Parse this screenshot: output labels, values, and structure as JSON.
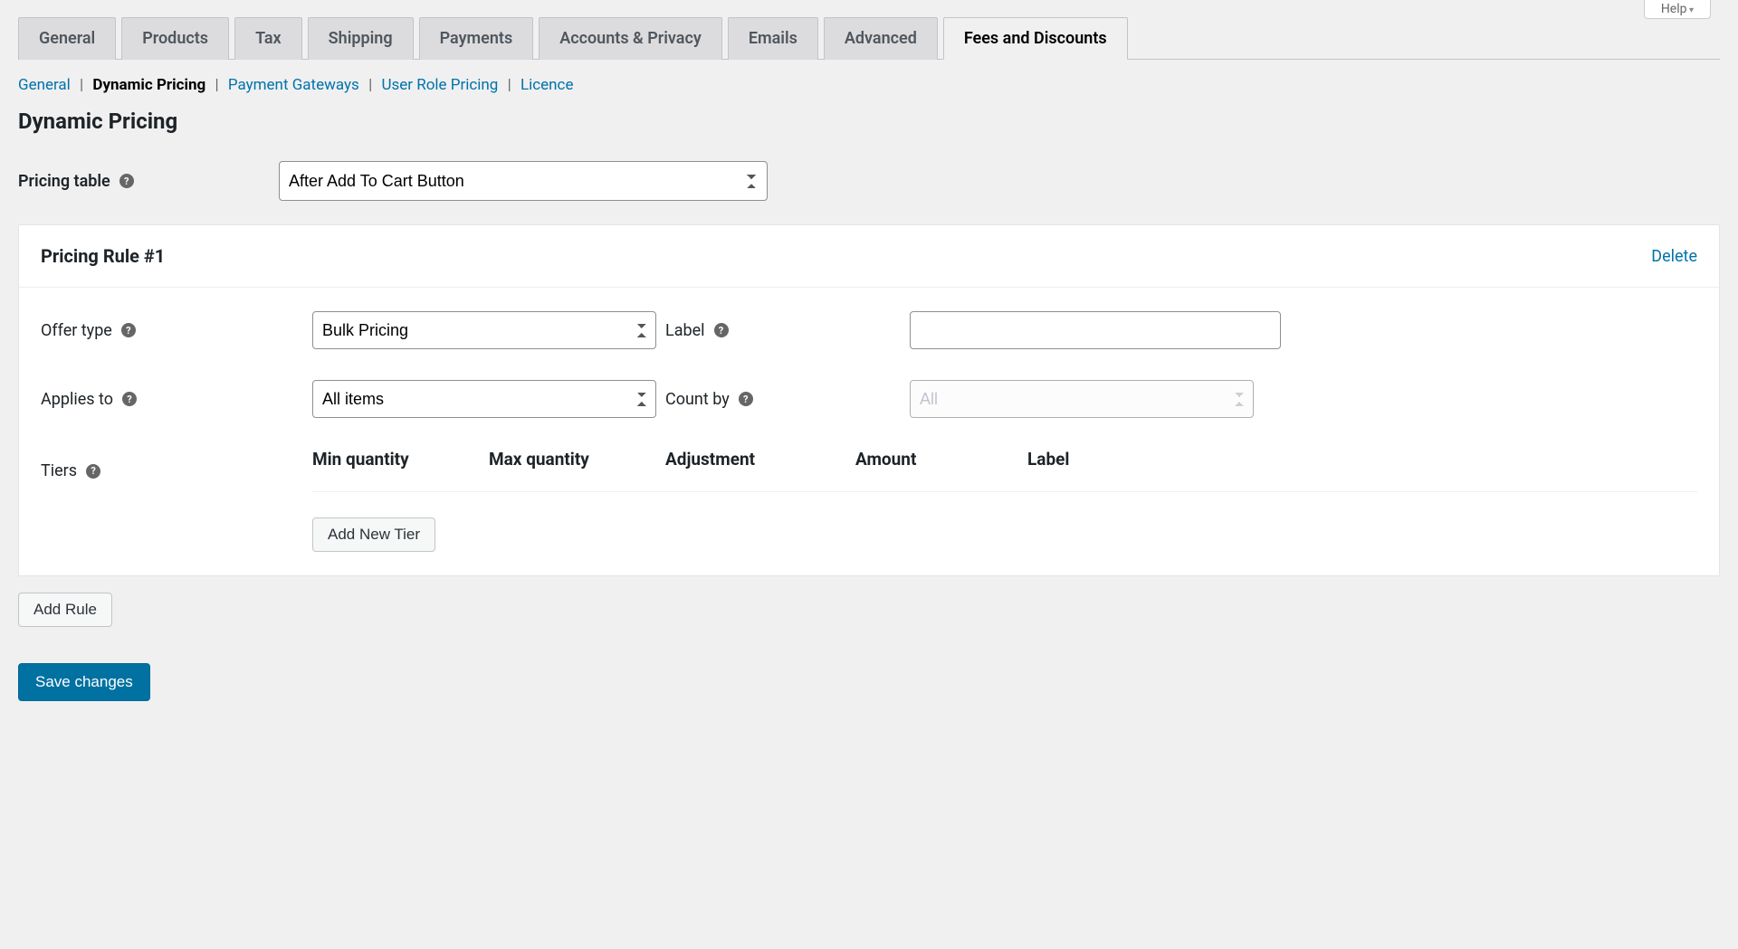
{
  "help_tab": "Help",
  "tabs": {
    "t0": "General",
    "t1": "Products",
    "t2": "Tax",
    "t3": "Shipping",
    "t4": "Payments",
    "t5": "Accounts & Privacy",
    "t6": "Emails",
    "t7": "Advanced",
    "t8": "Fees and Discounts"
  },
  "subnav": {
    "general": "General",
    "dynamic": "Dynamic Pricing",
    "gateways": "Payment Gateways",
    "roles": "User Role Pricing",
    "licence": "Licence"
  },
  "page_title": "Dynamic Pricing",
  "pricing_table": {
    "label": "Pricing table",
    "value": "After Add To Cart Button"
  },
  "rule": {
    "title": "Pricing Rule #1",
    "delete": "Delete",
    "offer_type_label": "Offer type",
    "offer_type_value": "Bulk Pricing",
    "label_label": "Label",
    "label_value": "",
    "applies_to_label": "Applies to",
    "applies_to_value": "All items",
    "count_by_label": "Count by",
    "count_by_value": "All",
    "tiers_label": "Tiers",
    "tiers_cols": {
      "c1": "Min quantity",
      "c2": "Max quantity",
      "c3": "Adjustment",
      "c4": "Amount",
      "c5": "Label"
    },
    "add_tier": "Add New Tier"
  },
  "add_rule": "Add Rule",
  "save": "Save changes",
  "help_q": "?"
}
